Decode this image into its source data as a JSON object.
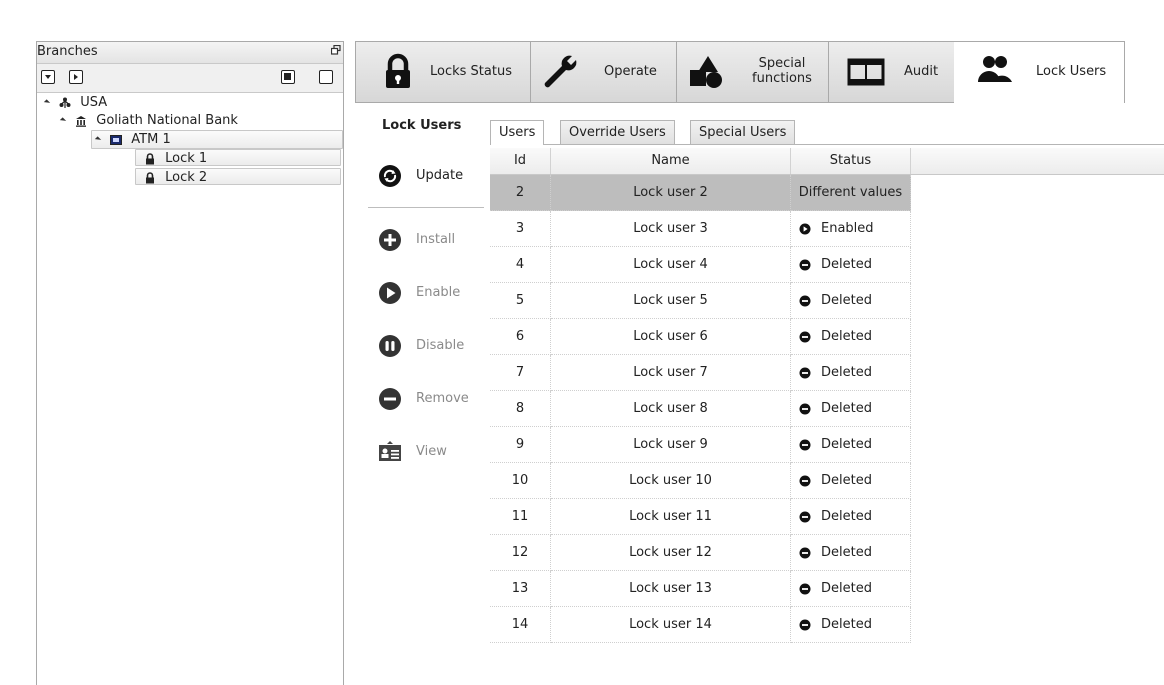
{
  "branches": {
    "title": "Branches",
    "tree": [
      {
        "label": "USA",
        "icon": "organization-icon",
        "level": 0
      },
      {
        "label": "Goliath National Bank",
        "icon": "bank-icon",
        "level": 1
      },
      {
        "label": "ATM 1",
        "icon": "atm-icon",
        "level": 2
      },
      {
        "label": "Lock 1",
        "icon": "padlock-icon",
        "level": 3
      },
      {
        "label": "Lock 2",
        "icon": "padlock-icon",
        "level": 3
      }
    ]
  },
  "modules": {
    "locks_status": "Locks Status",
    "operate": "Operate",
    "special_functions_1": "Special",
    "special_functions_2": "functions",
    "audit": "Audit",
    "lock_users": "Lock Users"
  },
  "actions": {
    "title": "Lock Users",
    "update": "Update",
    "install": "Install",
    "enable": "Enable",
    "disable": "Disable",
    "remove": "Remove",
    "view": "View"
  },
  "subtabs": {
    "users": "Users",
    "override": "Override Users",
    "special": "Special Users"
  },
  "table": {
    "headers": {
      "id": "Id",
      "name": "Name",
      "status": "Status"
    },
    "rows": [
      {
        "id": "2",
        "name": "Lock user 2",
        "status": "Different values"
      },
      {
        "id": "3",
        "name": "Lock user 3",
        "status": "Enabled"
      },
      {
        "id": "4",
        "name": "Lock user 4",
        "status": "Deleted"
      },
      {
        "id": "5",
        "name": "Lock user 5",
        "status": "Deleted"
      },
      {
        "id": "6",
        "name": "Lock user 6",
        "status": "Deleted"
      },
      {
        "id": "7",
        "name": "Lock user 7",
        "status": "Deleted"
      },
      {
        "id": "8",
        "name": "Lock user 8",
        "status": "Deleted"
      },
      {
        "id": "9",
        "name": "Lock user 9",
        "status": "Deleted"
      },
      {
        "id": "10",
        "name": "Lock user 10",
        "status": "Deleted"
      },
      {
        "id": "11",
        "name": "Lock user 11",
        "status": "Deleted"
      },
      {
        "id": "12",
        "name": "Lock user 12",
        "status": "Deleted"
      },
      {
        "id": "13",
        "name": "Lock user 13",
        "status": "Deleted"
      },
      {
        "id": "14",
        "name": "Lock user 14",
        "status": "Deleted"
      }
    ]
  }
}
